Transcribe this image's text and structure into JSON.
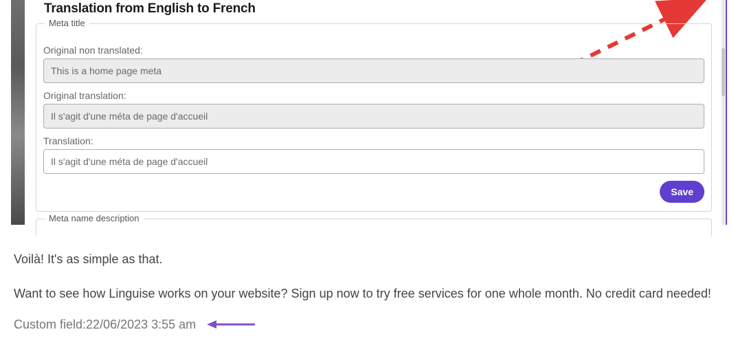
{
  "panel": {
    "title": "Translation from English to French",
    "meta_title_legend": "Meta title",
    "original_non_translated_label": "Original non translated:",
    "original_non_translated_value": "This is a home page meta",
    "original_translation_label": "Original translation:",
    "original_translation_value": "Il s'agit d'une méta de page d'accueil",
    "translation_label": "Translation:",
    "translation_value": "Il s'agit d'une méta de page d'accueil",
    "save_label": "Save",
    "meta_name_desc_legend": "Meta name description"
  },
  "article": {
    "p1": "Voilà! It's as simple as that.",
    "p2": "Want to see how Linguise works on your website? Sign up now to try free services for one whole month. No credit card needed!"
  },
  "custom_field": {
    "label": "Custom field: ",
    "value": "22/06/2023 3:55 am"
  },
  "colors": {
    "accent": "#5E3FD0",
    "arrow_red": "#E53935",
    "arrow_purple": "#7D4FC7"
  }
}
